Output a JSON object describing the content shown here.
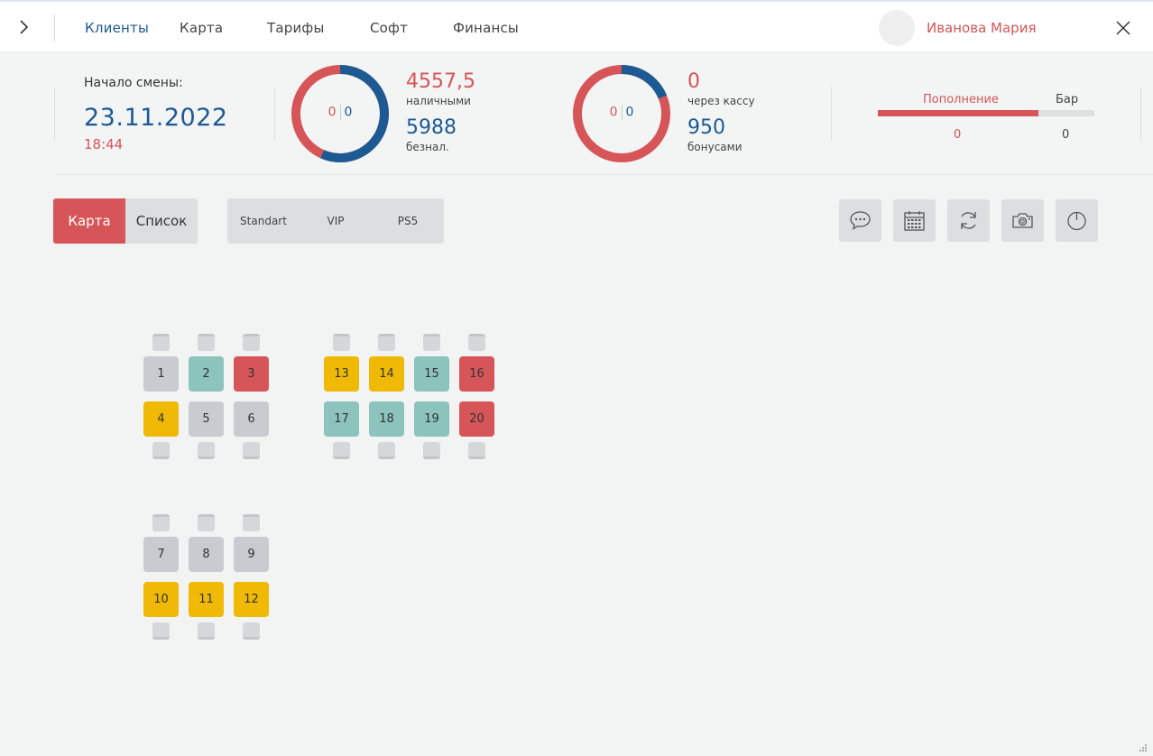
{
  "nav": {
    "items": [
      "Клиенты",
      "Карта",
      "Тарифы",
      "Софт",
      "Финансы"
    ],
    "active_index": 0
  },
  "user": {
    "name": "Иванова  Мария"
  },
  "shift": {
    "label": "Начало смены:",
    "date": "23.11.2022",
    "time": "18:44"
  },
  "donut1": {
    "left": "0",
    "right": "0",
    "amount1": "4557,5",
    "label1": "наличными",
    "amount2": "5988",
    "label2": "безнал."
  },
  "donut2": {
    "left": "0",
    "right": "0",
    "amount1": "0",
    "label1": "через кассу",
    "amount2": "950",
    "label2": "бонусами"
  },
  "balance": {
    "tab1": "Пополнение",
    "tab2": "Бар",
    "val1": "0",
    "val2": "0",
    "progress": 0.74
  },
  "view": {
    "map": "Карта",
    "list": "Список"
  },
  "zones": [
    "Standart",
    "VIP",
    "PS5"
  ],
  "tools": [
    "chat-icon",
    "calendar-icon",
    "refresh-icon",
    "camera-icon",
    "power-icon"
  ],
  "colors": {
    "accent_red": "#d65558",
    "brand_blue": "#1d5a94",
    "free": "#c9cbd1",
    "busy_teal": "#8cc3bd",
    "reserved_yellow": "#f0b905",
    "busy_red": "#d65558"
  },
  "seats": [
    {
      "n": "1",
      "status": "free"
    },
    {
      "n": "2",
      "status": "teal"
    },
    {
      "n": "3",
      "status": "red"
    },
    {
      "n": "4",
      "status": "yellow"
    },
    {
      "n": "5",
      "status": "free"
    },
    {
      "n": "6",
      "status": "free"
    },
    {
      "n": "7",
      "status": "free"
    },
    {
      "n": "8",
      "status": "free"
    },
    {
      "n": "9",
      "status": "free"
    },
    {
      "n": "10",
      "status": "yellow"
    },
    {
      "n": "11",
      "status": "yellow"
    },
    {
      "n": "12",
      "status": "yellow"
    },
    {
      "n": "13",
      "status": "yellow"
    },
    {
      "n": "14",
      "status": "yellow"
    },
    {
      "n": "15",
      "status": "teal"
    },
    {
      "n": "16",
      "status": "red"
    },
    {
      "n": "17",
      "status": "teal"
    },
    {
      "n": "18",
      "status": "teal"
    },
    {
      "n": "19",
      "status": "teal"
    },
    {
      "n": "20",
      "status": "red"
    }
  ]
}
